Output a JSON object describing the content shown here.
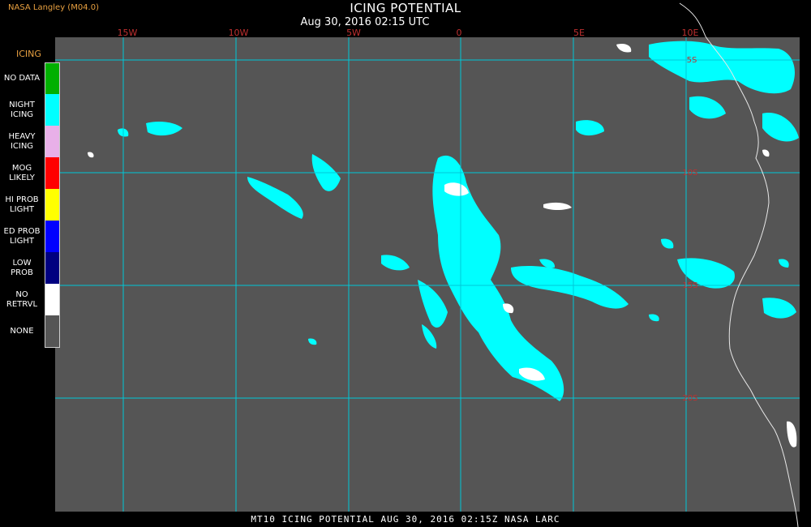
{
  "header": {
    "credit": "NASA Langley (M04.0)",
    "title": "ICING POTENTIAL",
    "datetime": "Aug 30, 2016 02:15 UTC"
  },
  "footer": {
    "caption": "MT10  ICING POTENTIAL  AUG 30, 2016 02:15Z  NASA LARC"
  },
  "colors": {
    "background": "#000000",
    "map_gray": "#555555",
    "grid": "#00c8d8",
    "lon_label": "#c03030",
    "icing_cyan": "#00ffff",
    "coast": "#e0e0e0"
  },
  "legend": {
    "title": "ICING",
    "items": [
      {
        "label": "NO DATA",
        "color": "#00b000"
      },
      {
        "label": "NIGHT\nICING",
        "color": "#00ffff"
      },
      {
        "label": "HEAVY\nICING",
        "color": "#e8b0e8"
      },
      {
        "label": "MOG\nLIKELY",
        "color": "#ff0000"
      },
      {
        "label": "HI PROB\nLIGHT",
        "color": "#ffff00"
      },
      {
        "label": "ED PROB\nLIGHT",
        "color": "#0000ff"
      },
      {
        "label": "LOW\nPROB",
        "color": "#000080"
      },
      {
        "label": "NO\nRETRVL",
        "color": "#ffffff"
      },
      {
        "label": "NONE",
        "color": "#555555"
      }
    ]
  },
  "map": {
    "lon_labels": [
      "15W",
      "10W",
      "5W",
      "0",
      "5E",
      "10E"
    ],
    "lat_labels": [
      "5S",
      "10S",
      "15S",
      "20S"
    ]
  }
}
